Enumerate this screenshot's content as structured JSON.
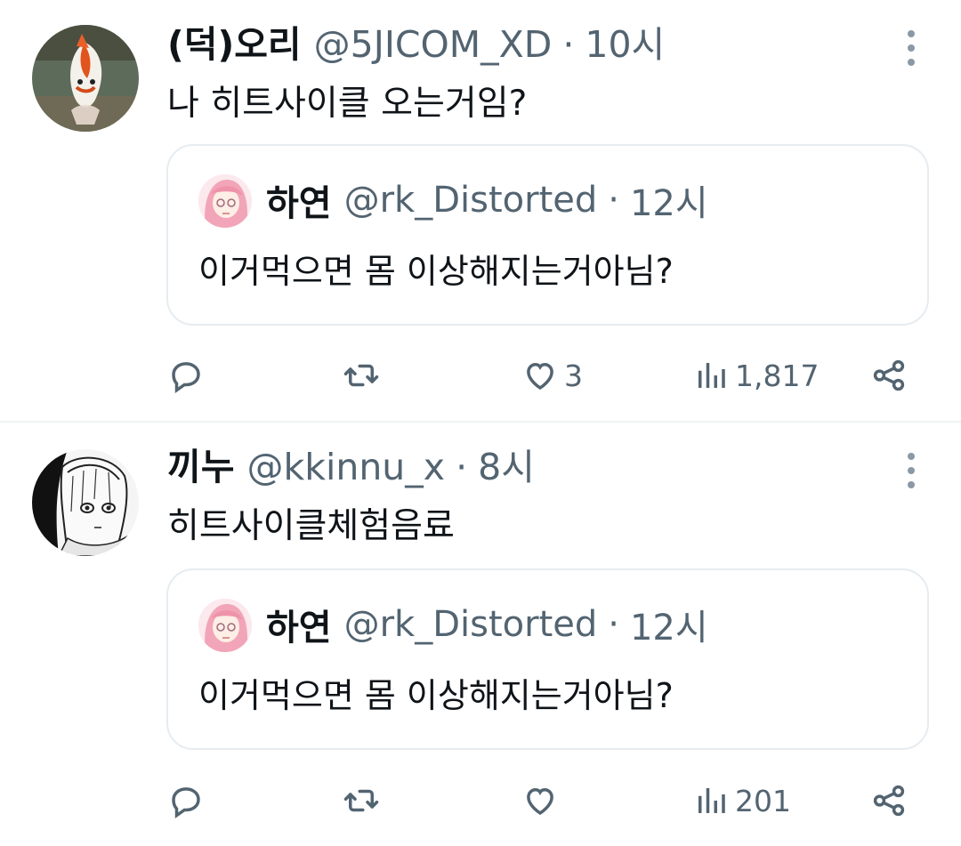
{
  "tweets": [
    {
      "name": "(덕)오리",
      "handle": "@5JICOM_XD",
      "dot": "·",
      "time": "10시",
      "text": "나 히트사이클 오는거임?",
      "avatar_icon": "goldfish-avatar",
      "quote": {
        "name": "하연",
        "handle": "@rk_Distorted",
        "dot": "·",
        "time": "12시",
        "text": "이거먹으면 몸 이상해지는거아님?",
        "avatar_icon": "pink-hair-character-avatar"
      },
      "stats": {
        "likes": "3",
        "views": "1,817"
      }
    },
    {
      "name": "끼누",
      "handle": "@kkinnu_x",
      "dot": "·",
      "time": "8시",
      "text": "히트사이클체험음료",
      "avatar_icon": "manga-character-avatar",
      "quote": {
        "name": "하연",
        "handle": "@rk_Distorted",
        "dot": "·",
        "time": "12시",
        "text": "이거먹으면 몸 이상해지는거아님?",
        "avatar_icon": "pink-hair-character-avatar"
      },
      "stats": {
        "likes": "",
        "views": "201"
      }
    }
  ],
  "icons": {
    "reply": "reply-icon",
    "retweet": "retweet-icon",
    "like": "heart-icon",
    "views": "views-chart-icon",
    "share": "share-icon",
    "more": "more-vertical-icon"
  },
  "colors": {
    "text": "#0f1419",
    "secondary": "#536471",
    "border": "#e6ecf0"
  }
}
